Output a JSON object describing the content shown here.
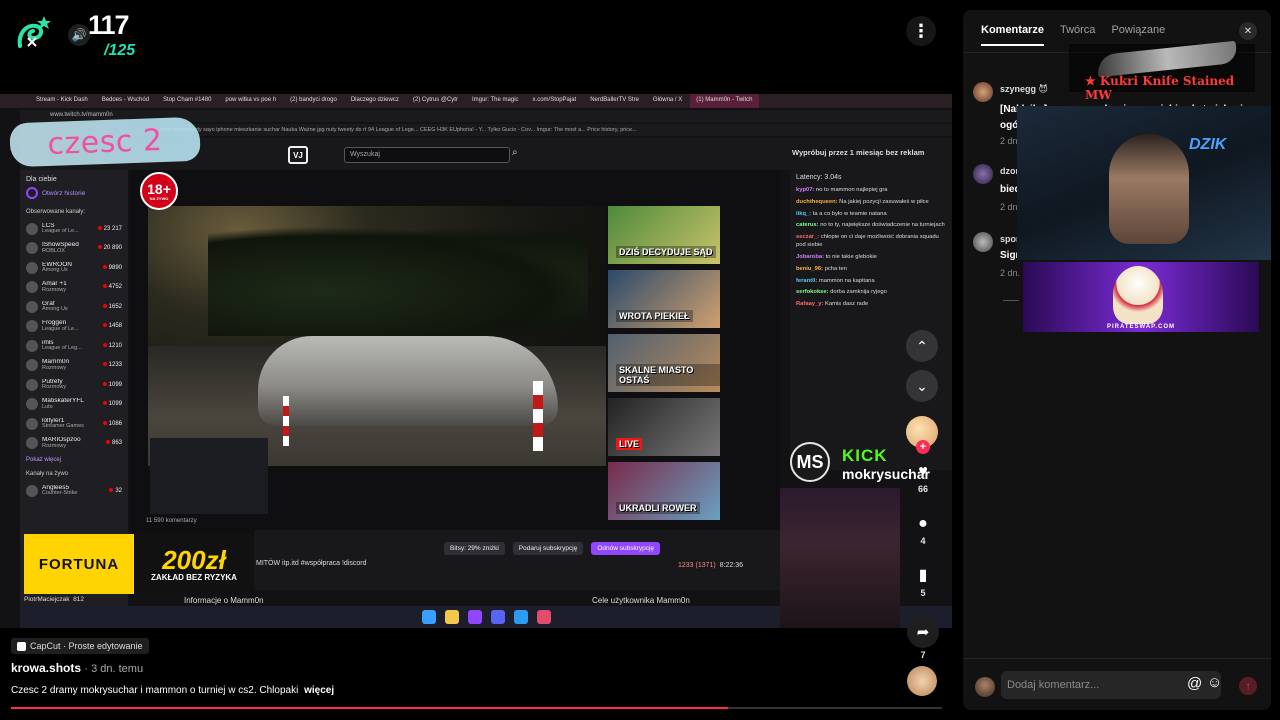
{
  "score": {
    "current": "117",
    "total": "/125",
    "logo_icon": "snake-mascot-icon",
    "volume_icon": "speaker-icon"
  },
  "header": {
    "more_icon": "more-vertical-icon"
  },
  "video": {
    "overlay_text": "czesc 2",
    "browser_tabs": [
      "Stream - Kick Dash",
      "Bedoes - Wschód",
      "Stop Cham #1480",
      "pow witka vs poe h",
      "(2) bandyci drogo",
      "Dlaczego dziewcz",
      "(2) Cytrus @Cytr",
      "Imgur: The magic",
      "x.com/StopPajat",
      "NerdBallerTV Stre",
      "Główna / X",
      "(1) Mamm0n - Twitch"
    ],
    "address": "www.twitch.tv/mamm0n",
    "bookmarks": "hody  samochody sayo  iphone  mieszkanie suchar  Nauka  Ważne jpg  nuty  tweety do rt  94 League of Lege...  CEEG  H3K EUphoria! - Y...  Tylko Gucio - Cov...  Imgur: The most a...  Price history, price...",
    "search_placeholder": "Wyszukaj",
    "prime_text": "Wypróbuj przez 1 miesiąc bez reklam",
    "sidebar": {
      "for_you": "Dla ciebie",
      "story": "Otwórz historie",
      "followed": "Obserwowane kanały:",
      "channels": [
        {
          "name": "LCS",
          "game": "League of Le...",
          "viewers": "23 217"
        },
        {
          "name": "IShowSpeed",
          "game": "ROBLOX",
          "viewers": "20 890"
        },
        {
          "name": "EWROON",
          "game": "Among Us",
          "viewers": "9890"
        },
        {
          "name": "Amar +1",
          "game": "Rozmowy",
          "viewers": "4752"
        },
        {
          "name": "Graf",
          "game": "Among Us",
          "viewers": "1652"
        },
        {
          "name": "Froggen",
          "game": "League of Le...",
          "viewers": "1458"
        },
        {
          "name": "imls",
          "game": "League of Leg...",
          "viewers": "1210"
        },
        {
          "name": "Mamm0n",
          "game": "Rozmowy",
          "viewers": "1233"
        },
        {
          "name": "Putrefy",
          "game": "Rozmowy",
          "viewers": "1099"
        },
        {
          "name": "MatiskaterYFL",
          "game": "Luto",
          "viewers": "1099"
        },
        {
          "name": "loltyler1",
          "game": "Streamer Games",
          "viewers": "1086"
        },
        {
          "name": "MARIOspzoo",
          "game": "Rozmowy",
          "viewers": "863"
        }
      ],
      "show_more": "Pokaż więcej",
      "live_channels": "Kanały na żywo",
      "live": [
        {
          "name": "Anglees5",
          "game": "Counter-Strike",
          "viewers": "32"
        }
      ]
    },
    "badge_18": "18+",
    "badge_18_sub": "NA ŻYWO",
    "thumbs": [
      "DZIŚ DECYDUJE SĄD",
      "WROTA PIEKIEŁ",
      "SKALNE MIASTO OSTAŚ",
      "LIVE",
      "UKRADLI ROWER"
    ],
    "player_meta": "11 590 komentarzy",
    "chat": {
      "latency": "Latency: 3.04s",
      "lines": [
        {
          "user": "kyp07:",
          "text": "no to mammon najlepiej gra"
        },
        {
          "user": "duchthequeen:",
          "text": "Na jakiej pozycji zasuwałeś w piłce"
        },
        {
          "user": "likq_:",
          "text": "ta a co było w teamie natana"
        },
        {
          "user": "caterus:",
          "text": "no to ty, największe doświadczenie na turniejach"
        },
        {
          "user": "seczar_:",
          "text": "chłopie on ci daje możliwość dobrania squadu pod siebie"
        },
        {
          "user": "Jobaroba:",
          "text": "to nie takie glebokie"
        },
        {
          "user": "beniu_96:",
          "text": "pcha ten"
        },
        {
          "user": "ferant0:",
          "text": "mammon na kapitana"
        },
        {
          "user": "serfokokse:",
          "text": "dorba zamknija ryjego"
        },
        {
          "user": "Rafaay_y:",
          "text": "Kamis dasz rade"
        }
      ]
    },
    "streamer": {
      "initials": "MS",
      "platform": "KICK",
      "handle": "mokrysuchar"
    },
    "fortuna": {
      "brand": "FORTUNA",
      "amount": "200zł",
      "promo": "ZAKŁAD BEZ RYZYKA"
    },
    "twitch_bottom": {
      "bits": "Bitsy: 29% zniżki",
      "gift": "Podaruj subskrypcję",
      "renew": "Odnów subskrypcję",
      "title": "MITÓW itp.itd #współpraca !discord",
      "viewers": "1233 (1371)",
      "uptime": "8:22:36",
      "about": "Informacje o Mamm0n",
      "goal": "Cele użytkownika Mamm0n",
      "pmc": "PiotrMaciejczak",
      "pmc_viewers": "812"
    }
  },
  "rail": {
    "likes": "66",
    "comments": "4",
    "saves": "5",
    "shares": "7"
  },
  "post": {
    "capcut": "CapCut · Proste edytowanie",
    "author": "krowa.shots",
    "when": "3 dn. temu",
    "description": "Czesc 2 dramy mokrysuchar i mammon o turniej w  cs2. Chlopaki",
    "more": "więcej",
    "progress": 0.77
  },
  "panel": {
    "tabs": [
      "Komentarze",
      "Twórca",
      "Powiązane"
    ],
    "comments": [
      {
        "user": "szynegg",
        "badge": "😈",
        "text": "[Naklejka] wszyscy cała wina na siebie ale to ich wina ogó",
        "date": "2 dn."
      },
      {
        "user": "dzon",
        "text": "bied",
        "date": "2 dn."
      },
      {
        "user": "spon",
        "text": "Sigma",
        "date": "2 dn."
      }
    ],
    "knife_ad": "★ Kukri Knife Stained MW",
    "dzik": "DZIK",
    "pirate_ad": "PIRATESWAP.COM",
    "comment_placeholder": "Dodaj komentarz..."
  }
}
